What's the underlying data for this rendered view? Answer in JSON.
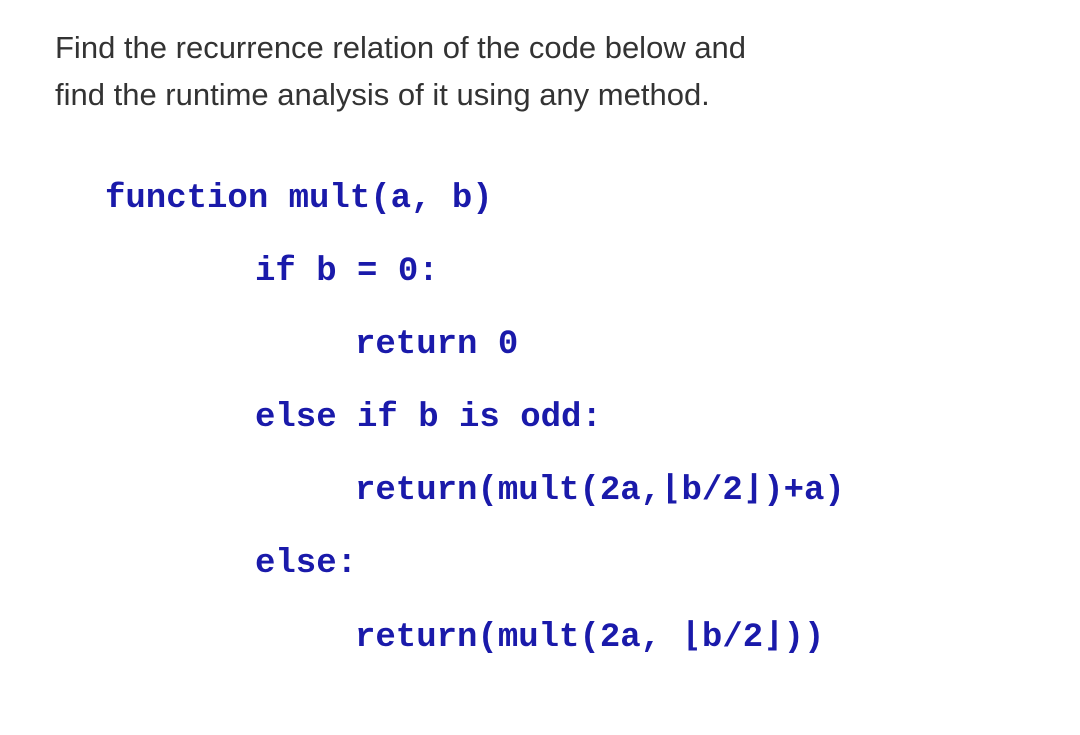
{
  "question": {
    "line1": "Find the recurrence relation of the code below and",
    "line2": "find the runtime analysis of it using any method."
  },
  "code": {
    "l1": "function mult(a, b)",
    "l2": "if b = 0:",
    "l3": "return 0",
    "l4": "else if b is odd:",
    "l5": "return(mult(2a,⌊b/2⌋)+a)",
    "l6": "else:",
    "l7": "return(mult(2a, ⌊b/2⌋))"
  }
}
